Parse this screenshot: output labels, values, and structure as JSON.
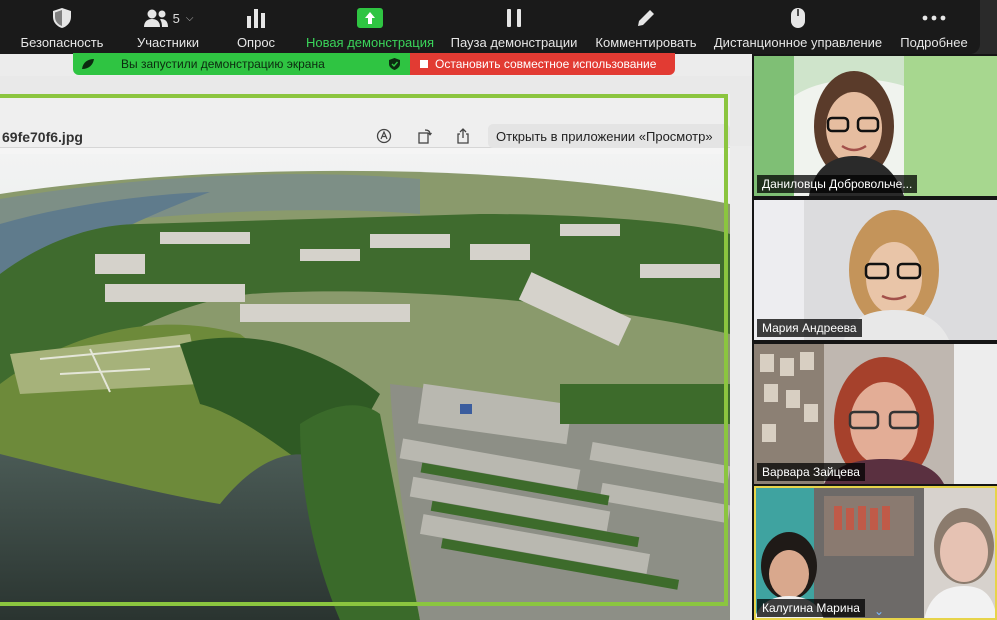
{
  "toolbar": {
    "items": [
      {
        "label": "Безопасность",
        "icon": "shield-icon"
      },
      {
        "label": "Участники",
        "icon": "participants-icon",
        "count": "5"
      },
      {
        "label": "Опрос",
        "icon": "poll-icon"
      },
      {
        "label": "Новая демонстрация",
        "icon": "new-share-icon"
      },
      {
        "label": "Пауза демонстрации",
        "icon": "pause-icon"
      },
      {
        "label": "Комментировать",
        "icon": "pencil-icon"
      },
      {
        "label": "Дистанционное управление",
        "icon": "mouse-icon"
      },
      {
        "label": "Подробнее",
        "icon": "more-icon"
      }
    ]
  },
  "sharing": {
    "status": "Вы запустили демонстрацию экрана",
    "stop_label": "Остановить совместное использование",
    "green": "#2fc442",
    "red": "#e23b33"
  },
  "viewer": {
    "filename": "69fe70f6.jpg",
    "open_in_label": "Открыть в приложении «Просмотр»"
  },
  "gallery": {
    "participants": [
      {
        "name": "Даниловцы Добровольче..."
      },
      {
        "name": "Мария Андреева"
      },
      {
        "name": "Варвара Зайцева"
      },
      {
        "name": "Калугина Марина"
      }
    ]
  },
  "colors": {
    "frame": "#8bc53f",
    "active_speaker": "#e7d44a"
  }
}
